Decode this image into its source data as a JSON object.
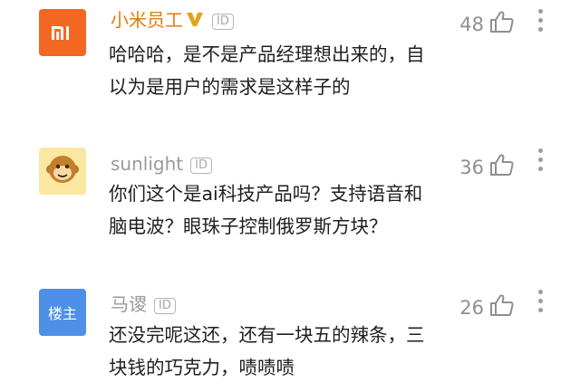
{
  "comments": [
    {
      "username": "小米员工",
      "id_tag": "ID",
      "avatar_icon": "xiaomi-logo-icon",
      "avatar_logo_text": "mi",
      "likes": "48",
      "text": "哈哈哈，是不是产品经理想出来的，自\n以为是用户的需求是这样子的"
    },
    {
      "username": "sunlight",
      "id_tag": "ID",
      "avatar_icon": "monkey-avatar-icon",
      "likes": "36",
      "text": "你们这个是ai科技产品吗？支持语音和\n脑电波？眼珠子控制俄罗斯方块？"
    },
    {
      "username": "马谡",
      "id_tag": "ID",
      "avatar_label": "楼主",
      "likes": "26",
      "text": "还没完呢这还，还有一块五的辣条，三\n块钱的巧克力，啧啧啧"
    }
  ],
  "colors": {
    "username_official": "#e27b10",
    "username_regular": "#9a9a9a",
    "xiaomi_orange": "#f26722",
    "host_blue": "#4f8fe8"
  }
}
